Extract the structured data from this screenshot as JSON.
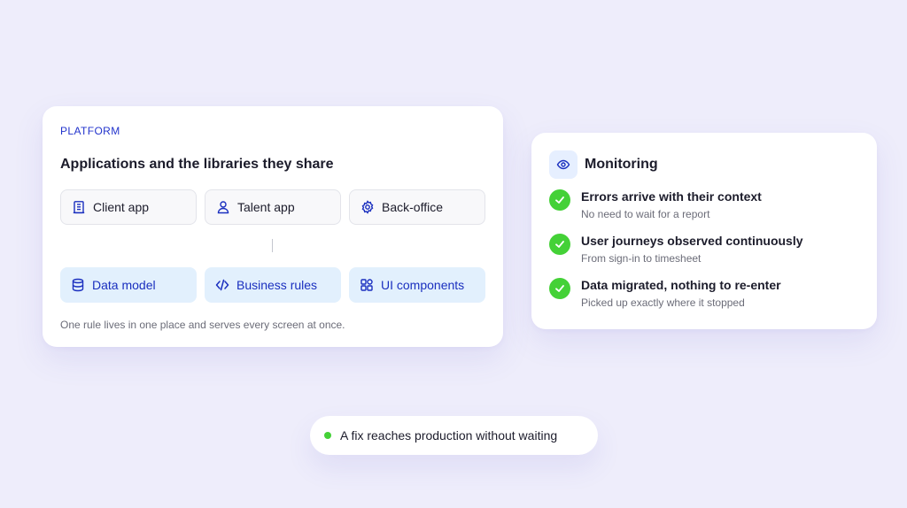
{
  "platform": {
    "eyebrow": "PLATFORM",
    "title": "Applications and the libraries they share",
    "apps": [
      {
        "label": "Client app",
        "icon": "building-icon"
      },
      {
        "label": "Talent app",
        "icon": "user-icon"
      },
      {
        "label": "Back-office",
        "icon": "gear-icon"
      }
    ],
    "libraries": [
      {
        "label": "Data model",
        "icon": "database-icon"
      },
      {
        "label": "Business rules",
        "icon": "code-icon"
      },
      {
        "label": "UI components",
        "icon": "grid-icon"
      }
    ],
    "footnote": "One rule lives in one place and serves every screen at once."
  },
  "monitoring": {
    "title": "Monitoring",
    "icon": "eye-icon",
    "items": [
      {
        "title": "Errors arrive with their context",
        "subtitle": "No need to wait for a report"
      },
      {
        "title": "User journeys observed continuously",
        "subtitle": "From sign-in to timesheet"
      },
      {
        "title": "Data migrated, nothing to re-enter",
        "subtitle": "Picked up exactly where it stopped"
      }
    ]
  },
  "status": {
    "text": "A fix reaches production without waiting",
    "dot_color": "#44d137"
  },
  "colors": {
    "accent": "#2233cc",
    "success": "#44d137",
    "background": "#eeedfb"
  }
}
